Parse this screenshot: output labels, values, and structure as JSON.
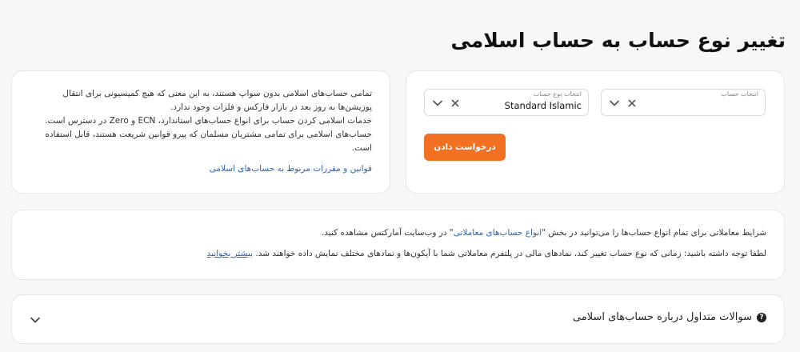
{
  "page": {
    "title": "تغییر نوع حساب به حساب اسلامی"
  },
  "form": {
    "account_select": {
      "label": "انتخاب حساب",
      "value": ""
    },
    "type_select": {
      "label": "انتخاب نوع حساب",
      "value": "Standard Islamic"
    },
    "submit_label": "درخواست دادن",
    "accent_color": "#f36f21"
  },
  "info": {
    "lines": [
      "تمامی حساب‌های اسلامی بدون سواپ هستند، به این معنی که هیچ کمیسیونی برای انتقال پوزیشن‌ها به روز بعد در بازار فارکس و فلزات وجود ندارد.",
      "خدمات اسلامی کردن حساب برای انواع حساب‌های استاندارد، ECN و Zero در دسترس است.",
      "حساب‌های اسلامی برای تمامی مشتریان مسلمان که پیرو قوانین شریعت هستند، قابل استفاده است."
    ],
    "rules_link": "قوانین و مقررات مربوط به حساب‌های اسلامی"
  },
  "notes": {
    "line1_before": "شرایط معاملاتی برای تمام انواع حساب‌ها را می‌توانید در بخش \"",
    "line1_link": "انواع حساب‌های معاملاتی",
    "line1_after": "\" در وب‌سایت آمارکتس مشاهده کنید.",
    "line2_text": "لطفا توجه داشته باشید: زمانی که نوع حساب تغییر کند، نمادهای مالی در پلتفرم معاملاتی شما با آیکون‌ها و نمادهای مختلف نمایش داده خواهند شد.",
    "line2_link": "بیشتر بخوانید"
  },
  "faq": {
    "title": "سوالات متداول درباره حساب‌های اسلامی",
    "icon": "question-circle-icon"
  },
  "icons": {
    "chevron": "chevron-down-icon",
    "clear": "close-icon"
  },
  "colors": {
    "link": "#2b64b5",
    "background": "#f7f7f8"
  }
}
